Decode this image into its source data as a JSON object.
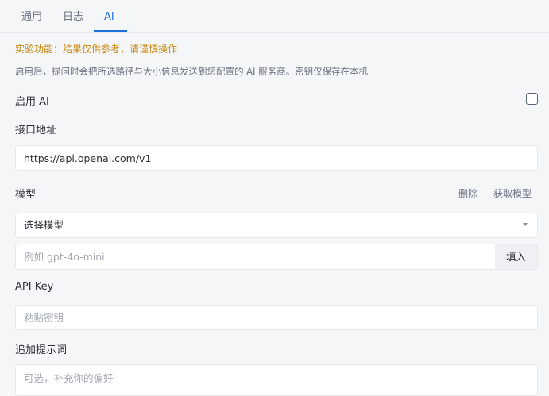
{
  "tabs": [
    {
      "label": "通用"
    },
    {
      "label": "日志"
    },
    {
      "label": "AI",
      "active": true
    }
  ],
  "notice": {
    "warning": "实验功能：结果仅供参考，请谨慎操作",
    "description": "启用后，提问时会把所选路径与大小信息发送到您配置的 AI 服务商。密钥仅保存在本机"
  },
  "enable_ai": {
    "label": "启用 AI",
    "checked": false
  },
  "endpoint": {
    "label": "接口地址",
    "value": "https://api.openai.com/v1"
  },
  "model": {
    "label": "模型",
    "delete_label": "删除",
    "fetch_label": "获取模型",
    "select_value": "选择模型",
    "custom_placeholder": "例如 gpt-4o-mini",
    "fill_label": "填入"
  },
  "api_key": {
    "label": "API Key",
    "placeholder": "粘贴密钥"
  },
  "extra_prompt": {
    "label": "追加提示词",
    "placeholder": "可选，补充你的偏好"
  },
  "colors": {
    "accent": "#1e6fe0",
    "warning": "#c8860d"
  }
}
